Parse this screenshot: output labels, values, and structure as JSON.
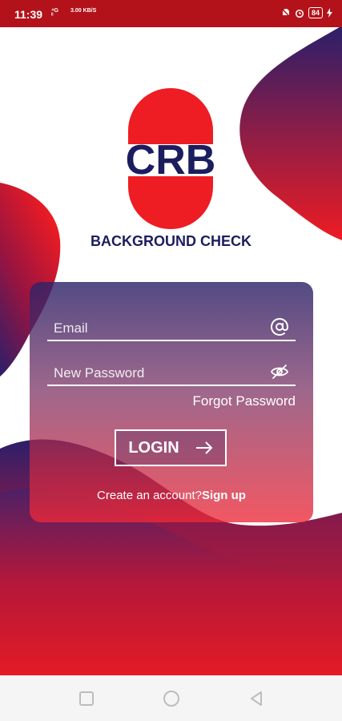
{
  "status_bar": {
    "time": "11:39",
    "net_indicator_1": "⁴G ⁺ᴵᴵ",
    "net_speed": "3.00 KB/S",
    "battery_level": "84"
  },
  "logo": {
    "text": "CRB",
    "subtitle": "BACKGROUND CHECK"
  },
  "login_form": {
    "email_placeholder": "Email",
    "password_placeholder": "New Password",
    "forgot_password_label": "Forgot Password",
    "login_button_label": "LOGIN",
    "create_account_text": "Create an account?",
    "sign_up_label": "Sign up"
  },
  "colors": {
    "brand_red": "#ee1c23",
    "brand_navy": "#1c1d5e",
    "status_bar": "#b3121a"
  },
  "icons": {
    "email": "at-sign-icon",
    "password": "eye-off-icon",
    "login": "arrow-right-icon"
  }
}
